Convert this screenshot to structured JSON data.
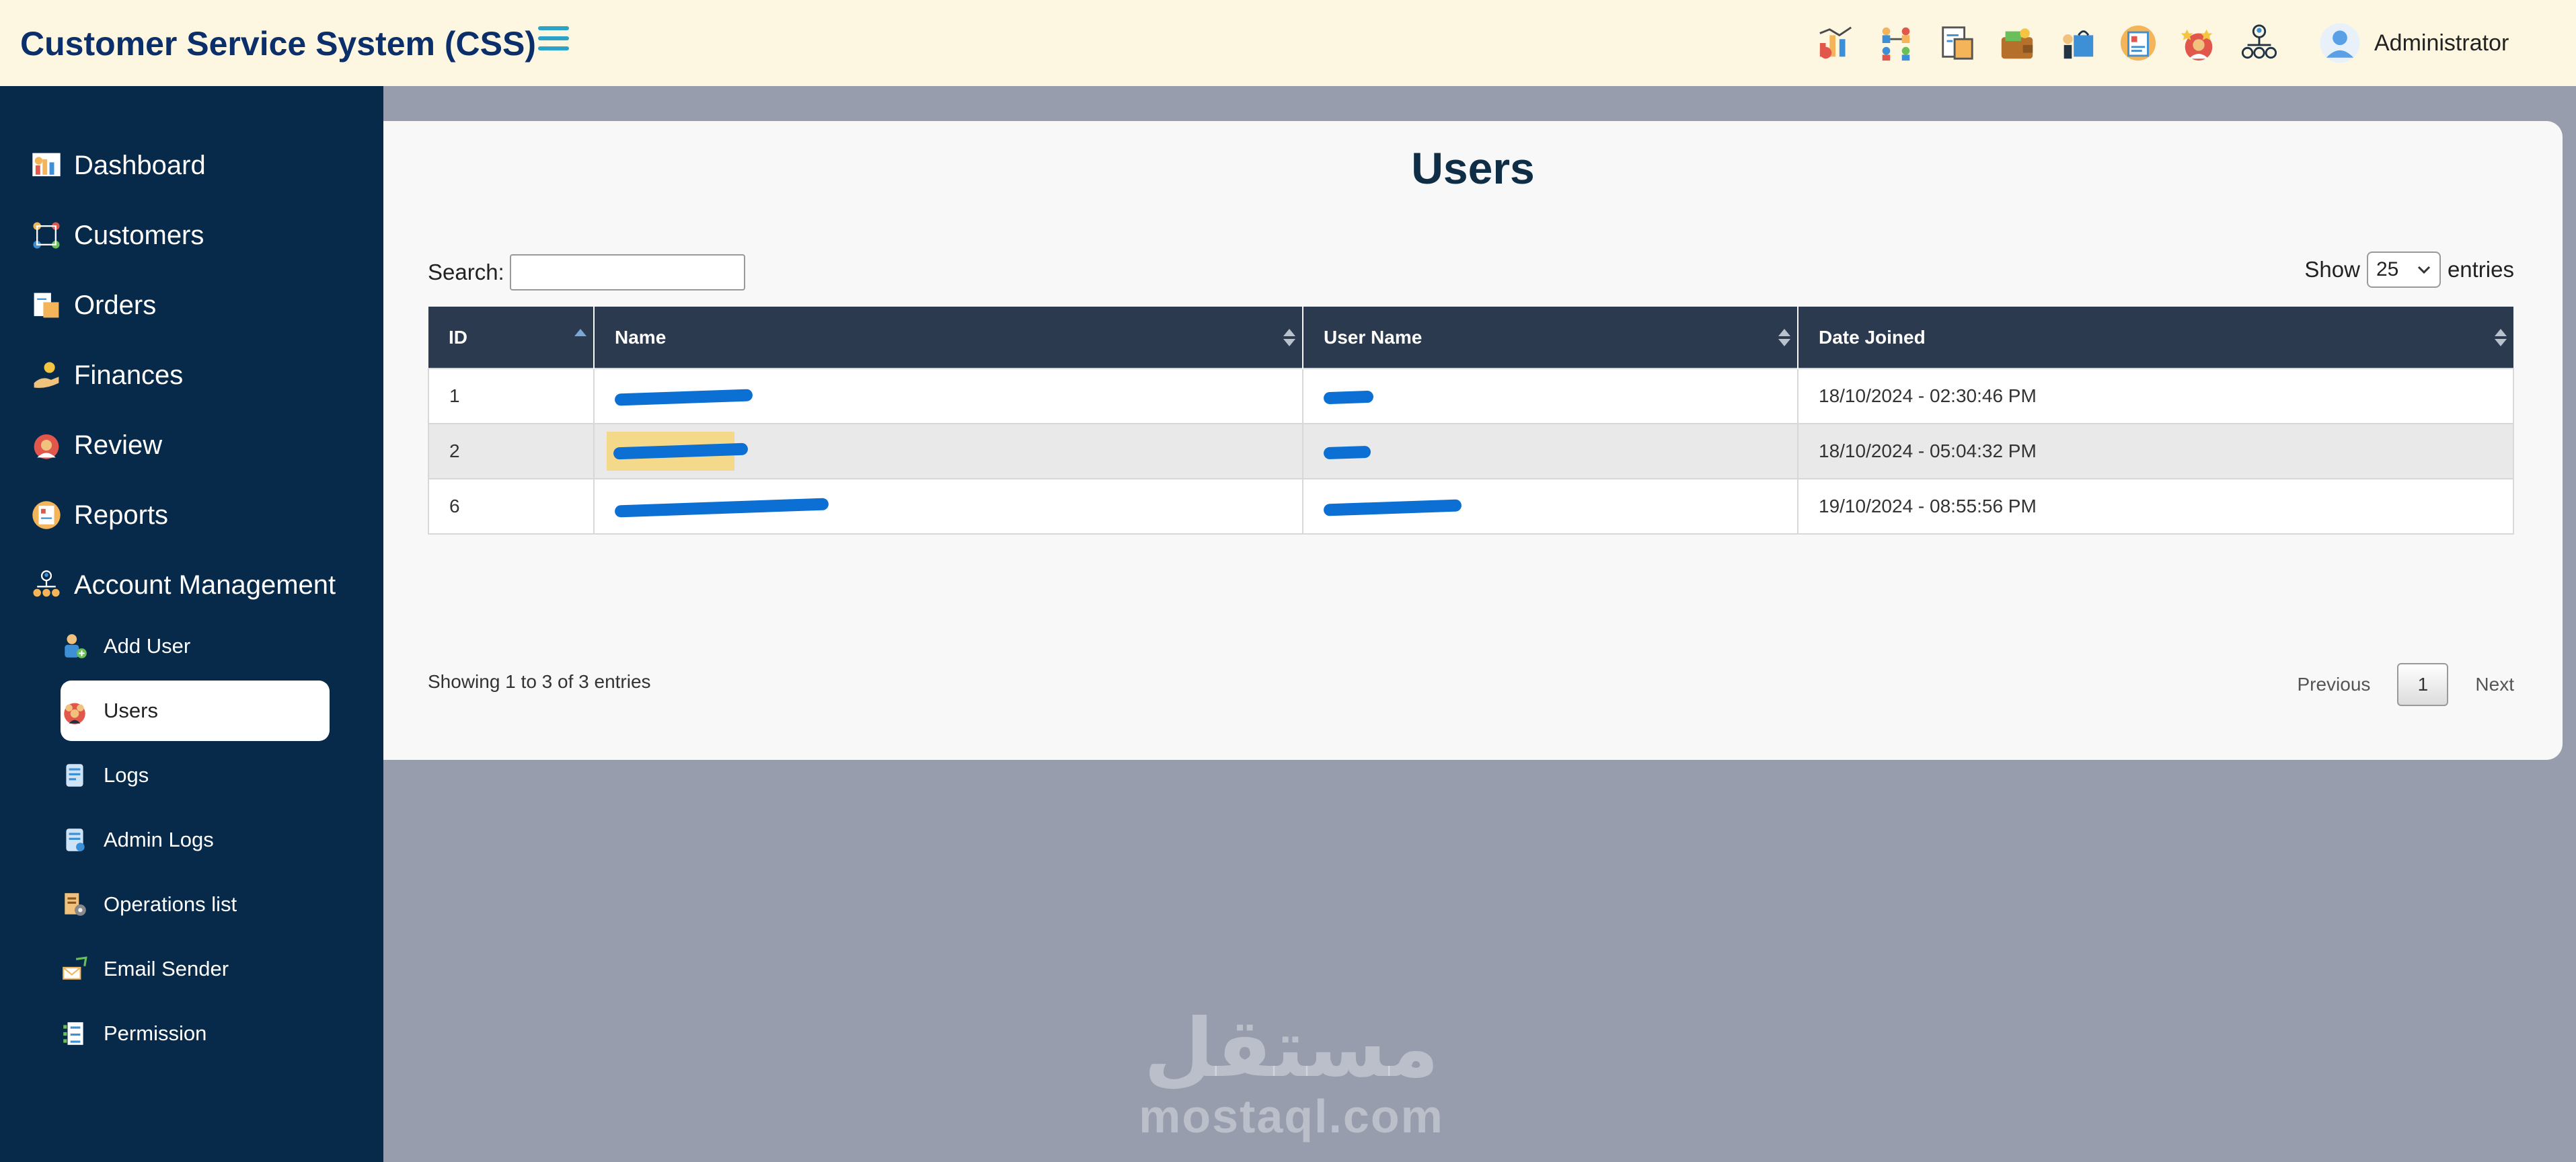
{
  "app": {
    "title": "Customer Service System (CSS)"
  },
  "header": {
    "icons": [
      "dashboard-icon",
      "customers-icon",
      "orders-icon",
      "finances-icon",
      "shopping-icon",
      "reports-icon",
      "review-icon",
      "account-management-icon"
    ],
    "user_name": "Administrator"
  },
  "sidebar": {
    "items": [
      {
        "label": "Dashboard",
        "icon": "dashboard-icon"
      },
      {
        "label": "Customers",
        "icon": "customers-icon"
      },
      {
        "label": "Orders",
        "icon": "orders-icon"
      },
      {
        "label": "Finances",
        "icon": "finances-icon"
      },
      {
        "label": "Review",
        "icon": "review-icon"
      },
      {
        "label": "Reports",
        "icon": "reports-icon"
      },
      {
        "label": "Account Management",
        "icon": "account-management-icon"
      }
    ],
    "sub_items": [
      {
        "label": "Add User",
        "icon": "add-user-icon"
      },
      {
        "label": "Users",
        "icon": "users-icon",
        "active": true
      },
      {
        "label": "Logs",
        "icon": "logs-icon"
      },
      {
        "label": "Admin Logs",
        "icon": "admin-logs-icon"
      },
      {
        "label": "Operations list",
        "icon": "operations-list-icon"
      },
      {
        "label": "Email Sender",
        "icon": "email-sender-icon"
      },
      {
        "label": "Permission",
        "icon": "permission-icon"
      }
    ]
  },
  "main": {
    "title": "Users",
    "search_label": "Search:",
    "search_value": "",
    "show_label": "Show",
    "entries_label": "entries",
    "page_length": "25",
    "table": {
      "columns": [
        "ID",
        "Name",
        "User Name",
        "Date Joined"
      ],
      "rows": [
        {
          "id": "1",
          "name": "[redacted]",
          "username": "[redacted]",
          "date": "18/10/2024 - 02:30:46 PM"
        },
        {
          "id": "2",
          "name": "[redacted]",
          "username": "[redacted]",
          "date": "18/10/2024 - 05:04:32 PM"
        },
        {
          "id": "6",
          "name": "[redacted]",
          "username": "[redacted]",
          "date": "19/10/2024 - 08:55:56 PM"
        }
      ]
    },
    "info": "Showing 1 to 3 of 3 entries",
    "pagination": {
      "previous": "Previous",
      "current": "1",
      "next": "Next"
    }
  },
  "watermark": {
    "arabic": "مستقل",
    "latin": "mostaql.com"
  },
  "colors": {
    "header_bg": "#fdf7e1",
    "sidebar_bg": "#07294a",
    "title": "#0b2f6b",
    "table_head": "#2b3a4e",
    "redaction": "#0b6fd4"
  }
}
